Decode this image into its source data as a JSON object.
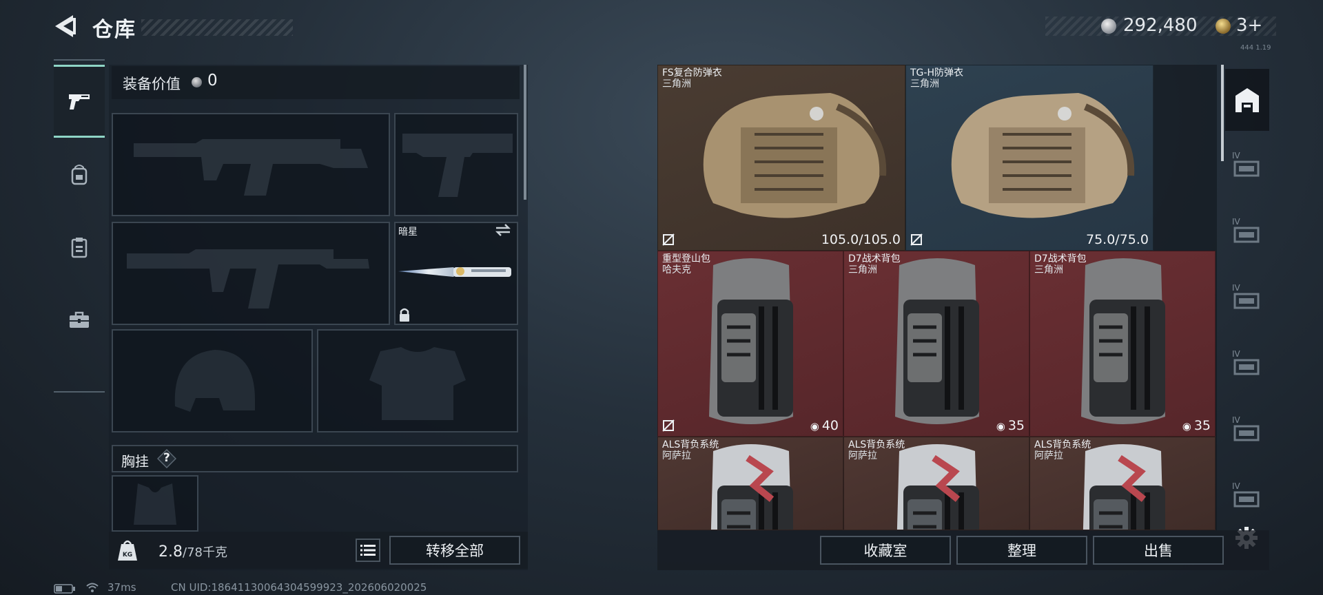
{
  "header": {
    "title": "仓库",
    "currency": "292,480",
    "tickets": "3+",
    "tiny_id": "444 1.19"
  },
  "left_rail": [
    {
      "icon": "pistol-icon",
      "active": true
    },
    {
      "icon": "backpack-icon",
      "active": false
    },
    {
      "icon": "clipboard-icon",
      "active": false
    },
    {
      "icon": "toolbox-icon",
      "active": false
    }
  ],
  "equipment": {
    "value_label": "装备价值",
    "value": "0",
    "knife_name": "暗星",
    "chest_label": "胸挂",
    "help": "?"
  },
  "weight": {
    "current": "2.8",
    "max": "/78千克"
  },
  "buttons": {
    "transfer_all": "转移全部",
    "collection": "收藏室",
    "organize": "整理",
    "sell": "出售"
  },
  "status": {
    "ping": "37ms",
    "uid": "CN UID:18641130064304599923_202606020025"
  },
  "storage": [
    {
      "name": "FS复合防弹衣",
      "maker": "三角洲",
      "stat": "105.0/105.0",
      "bg": "brown",
      "bound": true,
      "kind": "vest"
    },
    {
      "name": "TG-H防弹衣",
      "maker": "三角洲",
      "stat": "75.0/75.0",
      "bg": "blue",
      "bound": true,
      "kind": "vest"
    },
    {
      "name": "重型登山包",
      "maker": "哈夫克",
      "stat": "40",
      "bg": "red",
      "bound": true,
      "kind": "backpack"
    },
    {
      "name": "D7战术背包",
      "maker": "三角洲",
      "stat": "35",
      "bg": "red",
      "bound": false,
      "kind": "backpack"
    },
    {
      "name": "D7战术背包",
      "maker": "三角洲",
      "stat": "35",
      "bg": "red",
      "bound": false,
      "kind": "backpack"
    },
    {
      "name": "ALS背负系统",
      "maker": "阿萨拉",
      "stat": "",
      "bg": "dkred",
      "bound": false,
      "kind": "backpack"
    },
    {
      "name": "ALS背负系统",
      "maker": "阿萨拉",
      "stat": "",
      "bg": "dkred",
      "bound": false,
      "kind": "backpack"
    },
    {
      "name": "ALS背负系统",
      "maker": "阿萨拉",
      "stat": "",
      "bg": "dkred",
      "bound": false,
      "kind": "backpack"
    }
  ],
  "right_rail": [
    {
      "icon": "storage-home-icon",
      "label": ""
    },
    {
      "icon": "storage-extension-icon",
      "label": "IV"
    },
    {
      "icon": "storage-extension-icon",
      "label": "IV"
    },
    {
      "icon": "storage-extension-icon",
      "label": "IV"
    },
    {
      "icon": "storage-extension-icon",
      "label": "IV"
    },
    {
      "icon": "storage-extension-icon",
      "label": "IV"
    },
    {
      "icon": "storage-extension-icon",
      "label": "IV"
    }
  ]
}
